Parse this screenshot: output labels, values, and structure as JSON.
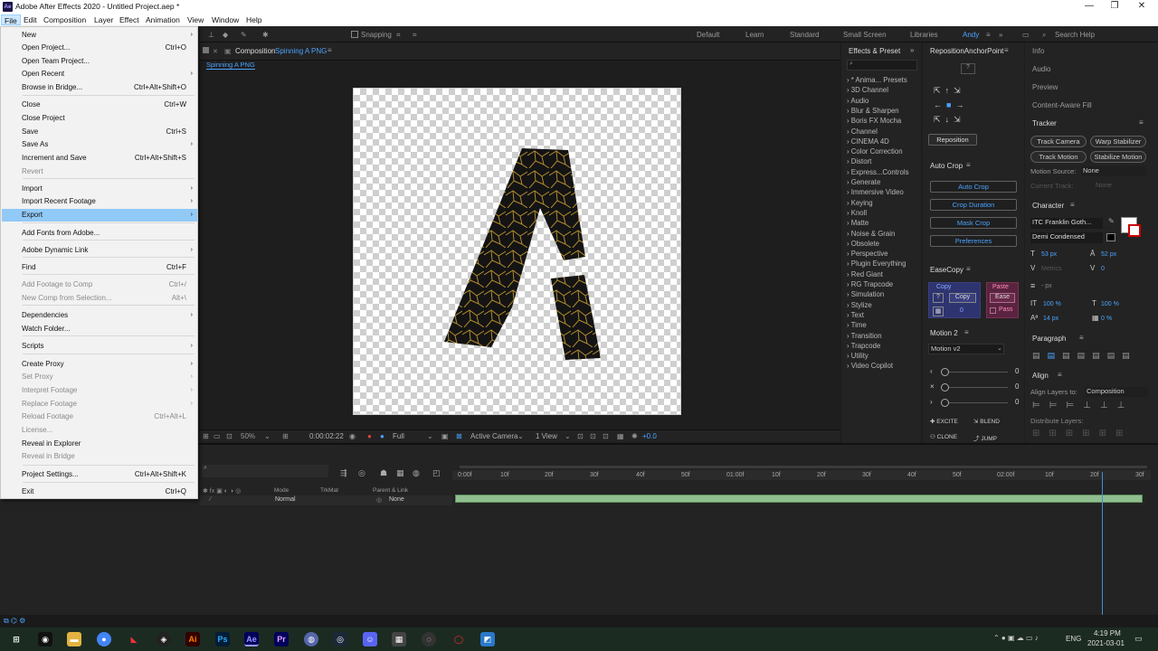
{
  "window": {
    "title": "Adobe After Effects 2020 - Untitled Project.aep *",
    "logo": "Ae",
    "min": "—",
    "max": "❐",
    "close": "✕"
  },
  "menubar": [
    "File",
    "Edit",
    "Composition",
    "Layer",
    "Effect",
    "Animation",
    "View",
    "Window",
    "Help"
  ],
  "toolbar": {
    "snapping": "Snapping",
    "workspaces": [
      "Default",
      "Learn",
      "Standard",
      "Small Screen",
      "Libraries",
      "Andy"
    ],
    "search": "Search Help"
  },
  "composition": {
    "tab_label": "Composition",
    "comp_name": "Spinning A PNG",
    "sub_tab": "Spinning A PNG"
  },
  "viewer_bar": {
    "zoom": "50%",
    "timecode": "0:00:02:22",
    "resolution": "Full",
    "camera": "Active Camera",
    "views": "1 View",
    "exposure": "+0.0"
  },
  "effects_panel": {
    "title": "Effects & Preset",
    "items": [
      "* Anima... Presets",
      "3D Channel",
      "Audio",
      "Blur & Sharpen",
      "Boris FX Mocha",
      "Channel",
      "CINEMA 4D",
      "Color Correction",
      "Distort",
      "Express...Controls",
      "Generate",
      "Immersive Video",
      "Keying",
      "Knoll",
      "Matte",
      "Noise & Grain",
      "Obsolete",
      "Perspective",
      "Plugin Everything",
      "Red Giant",
      "RG Trapcode",
      "Simulation",
      "Stylize",
      "Text",
      "Time",
      "Transition",
      "Trapcode",
      "Utility",
      "Video Copilot"
    ]
  },
  "anchor_panel": {
    "title": "RepositionAnchorPoint",
    "reposition": "Reposition",
    "autocrop_title": "Auto Crop",
    "autocrop_buttons": [
      "Auto Crop",
      "Crop Duration",
      "Mask Crop",
      "Preferences"
    ],
    "easecopy_title": "EaseCopy",
    "copy": "Copy",
    "copy_btn": "Copy",
    "copy_val": "0",
    "paste": "Paste",
    "ease": "Ease",
    "pass": "Pass",
    "motion_title": "Motion 2",
    "motion_select": "Motion v2",
    "slider_values": [
      "0",
      "0",
      "0"
    ],
    "excite": "EXCITE",
    "blend": "BLEND",
    "clone": "CLONE",
    "jump": "JUMP"
  },
  "right_panel": {
    "items": [
      "Info",
      "Audio",
      "Preview",
      "Content-Aware Fill"
    ],
    "tracker_title": "Tracker",
    "tracker_buttons": [
      "Track Camera",
      "Warp Stabilizer",
      "Track Motion",
      "Stabilize Motion"
    ],
    "motion_source_label": "Motion Source:",
    "motion_source": "None",
    "current_track_label": "Current Track:",
    "current_track": "None",
    "character_title": "Character",
    "font": "ITC Franklin Goth...",
    "style": "Demi Condensed",
    "font_size": "53 px",
    "leading": "52 px",
    "metrics": "Metrics",
    "tracking": "0",
    "stroke": "- px",
    "vscale": "100 %",
    "hscale": "100 %",
    "baseline": "14 px",
    "tsume": "0 %",
    "paragraph_title": "Paragraph",
    "align_title": "Align",
    "align_to_label": "Align Layers to:",
    "align_to": "Composition",
    "distribute": "Distribute Layers:"
  },
  "timeline": {
    "columns": {
      "mode": "Mode",
      "trkmat": "TrkMat",
      "parent": "Parent & Link"
    },
    "layer": {
      "mode": "Normal",
      "parent": "None"
    },
    "ruler": [
      "0:00f",
      "10f",
      "20f",
      "30f",
      "40f",
      "50f",
      "01:00f",
      "10f",
      "20f",
      "30f",
      "40f",
      "50f",
      "02:00f",
      "10f",
      "20f",
      "30f"
    ]
  },
  "taskbar": {
    "lang": "ENG",
    "time": "4:19 PM",
    "date": "2021-03-01"
  },
  "file_menu": {
    "items": [
      {
        "label": "New",
        "shortcut": "",
        "arrow": true,
        "disabled": false
      },
      {
        "label": "Open Project...",
        "shortcut": "Ctrl+O",
        "arrow": false,
        "disabled": false
      },
      {
        "label": "Open Team Project...",
        "shortcut": "",
        "arrow": false,
        "disabled": false
      },
      {
        "label": "Open Recent",
        "shortcut": "",
        "arrow": true,
        "disabled": false
      },
      {
        "label": "Browse in Bridge...",
        "shortcut": "Ctrl+Alt+Shift+O",
        "arrow": false,
        "disabled": false
      },
      {
        "label": "Close",
        "shortcut": "Ctrl+W",
        "arrow": false,
        "disabled": false
      },
      {
        "label": "Close Project",
        "shortcut": "",
        "arrow": false,
        "disabled": false
      },
      {
        "label": "Save",
        "shortcut": "Ctrl+S",
        "arrow": false,
        "disabled": false
      },
      {
        "label": "Save As",
        "shortcut": "",
        "arrow": true,
        "disabled": false
      },
      {
        "label": "Increment and Save",
        "shortcut": "Ctrl+Alt+Shift+S",
        "arrow": false,
        "disabled": false
      },
      {
        "label": "Revert",
        "shortcut": "",
        "arrow": false,
        "disabled": true
      },
      {
        "label": "Import",
        "shortcut": "",
        "arrow": true,
        "disabled": false
      },
      {
        "label": "Import Recent Footage",
        "shortcut": "",
        "arrow": true,
        "disabled": false
      },
      {
        "label": "Export",
        "shortcut": "",
        "arrow": true,
        "disabled": false,
        "highlight": true
      },
      {
        "label": "Add Fonts from Adobe...",
        "shortcut": "",
        "arrow": false,
        "disabled": false
      },
      {
        "label": "Adobe Dynamic Link",
        "shortcut": "",
        "arrow": true,
        "disabled": false
      },
      {
        "label": "Find",
        "shortcut": "Ctrl+F",
        "arrow": false,
        "disabled": false
      },
      {
        "label": "Add Footage to Comp",
        "shortcut": "Ctrl+/",
        "arrow": false,
        "disabled": true
      },
      {
        "label": "New Comp from Selection...",
        "shortcut": "Alt+\\",
        "arrow": false,
        "disabled": true
      },
      {
        "label": "Dependencies",
        "shortcut": "",
        "arrow": true,
        "disabled": false
      },
      {
        "label": "Watch Folder...",
        "shortcut": "",
        "arrow": false,
        "disabled": false
      },
      {
        "label": "Scripts",
        "shortcut": "",
        "arrow": true,
        "disabled": false
      },
      {
        "label": "Create Proxy",
        "shortcut": "",
        "arrow": true,
        "disabled": false
      },
      {
        "label": "Set Proxy",
        "shortcut": "",
        "arrow": true,
        "disabled": true
      },
      {
        "label": "Interpret Footage",
        "shortcut": "",
        "arrow": true,
        "disabled": true
      },
      {
        "label": "Replace Footage",
        "shortcut": "",
        "arrow": true,
        "disabled": true
      },
      {
        "label": "Reload Footage",
        "shortcut": "Ctrl+Alt+L",
        "arrow": false,
        "disabled": true
      },
      {
        "label": "License...",
        "shortcut": "",
        "arrow": false,
        "disabled": true
      },
      {
        "label": "Reveal in Explorer",
        "shortcut": "",
        "arrow": false,
        "disabled": false
      },
      {
        "label": "Reveal in Bridge",
        "shortcut": "",
        "arrow": false,
        "disabled": true
      },
      {
        "label": "Project Settings...",
        "shortcut": "Ctrl+Alt+Shift+K",
        "arrow": false,
        "disabled": false
      },
      {
        "label": "Exit",
        "shortcut": "Ctrl+Q",
        "arrow": false,
        "disabled": false
      }
    ]
  }
}
